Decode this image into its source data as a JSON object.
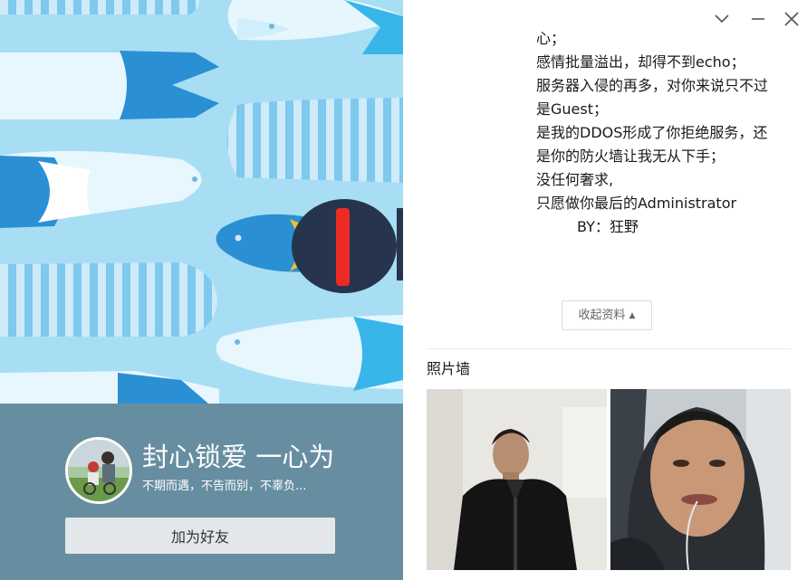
{
  "profile": {
    "nickname": "封心锁爱 一心为你",
    "signature": "不期而遇，不告而别，不辜负...",
    "add_friend_label": "加为好友"
  },
  "window_controls": {
    "collapse_icon": "chevron-down-icon",
    "minimize_icon": "minimize-icon",
    "close_icon": "close-icon"
  },
  "bio": {
    "lines": [
      "心；",
      "感情批量溢出，却得不到echo；",
      "服务器入侵的再多，对你来说只不过",
      "是Guest；",
      "是我的DDOS形成了你拒绝服务，还",
      "是你的防火墙让我无从下手；",
      "没任何奢求,",
      "只愿做你最后的Administrator",
      "BY：狂野"
    ]
  },
  "collapse_button": {
    "label": "收起资料",
    "arrow": "▲"
  },
  "photo_wall": {
    "title": "照片墙",
    "photos": [
      "photo-1",
      "photo-2"
    ]
  },
  "colors": {
    "cover_bg": "#a7def4",
    "profile_band": "#678ea0",
    "button_bg": "#e3e7ea"
  }
}
